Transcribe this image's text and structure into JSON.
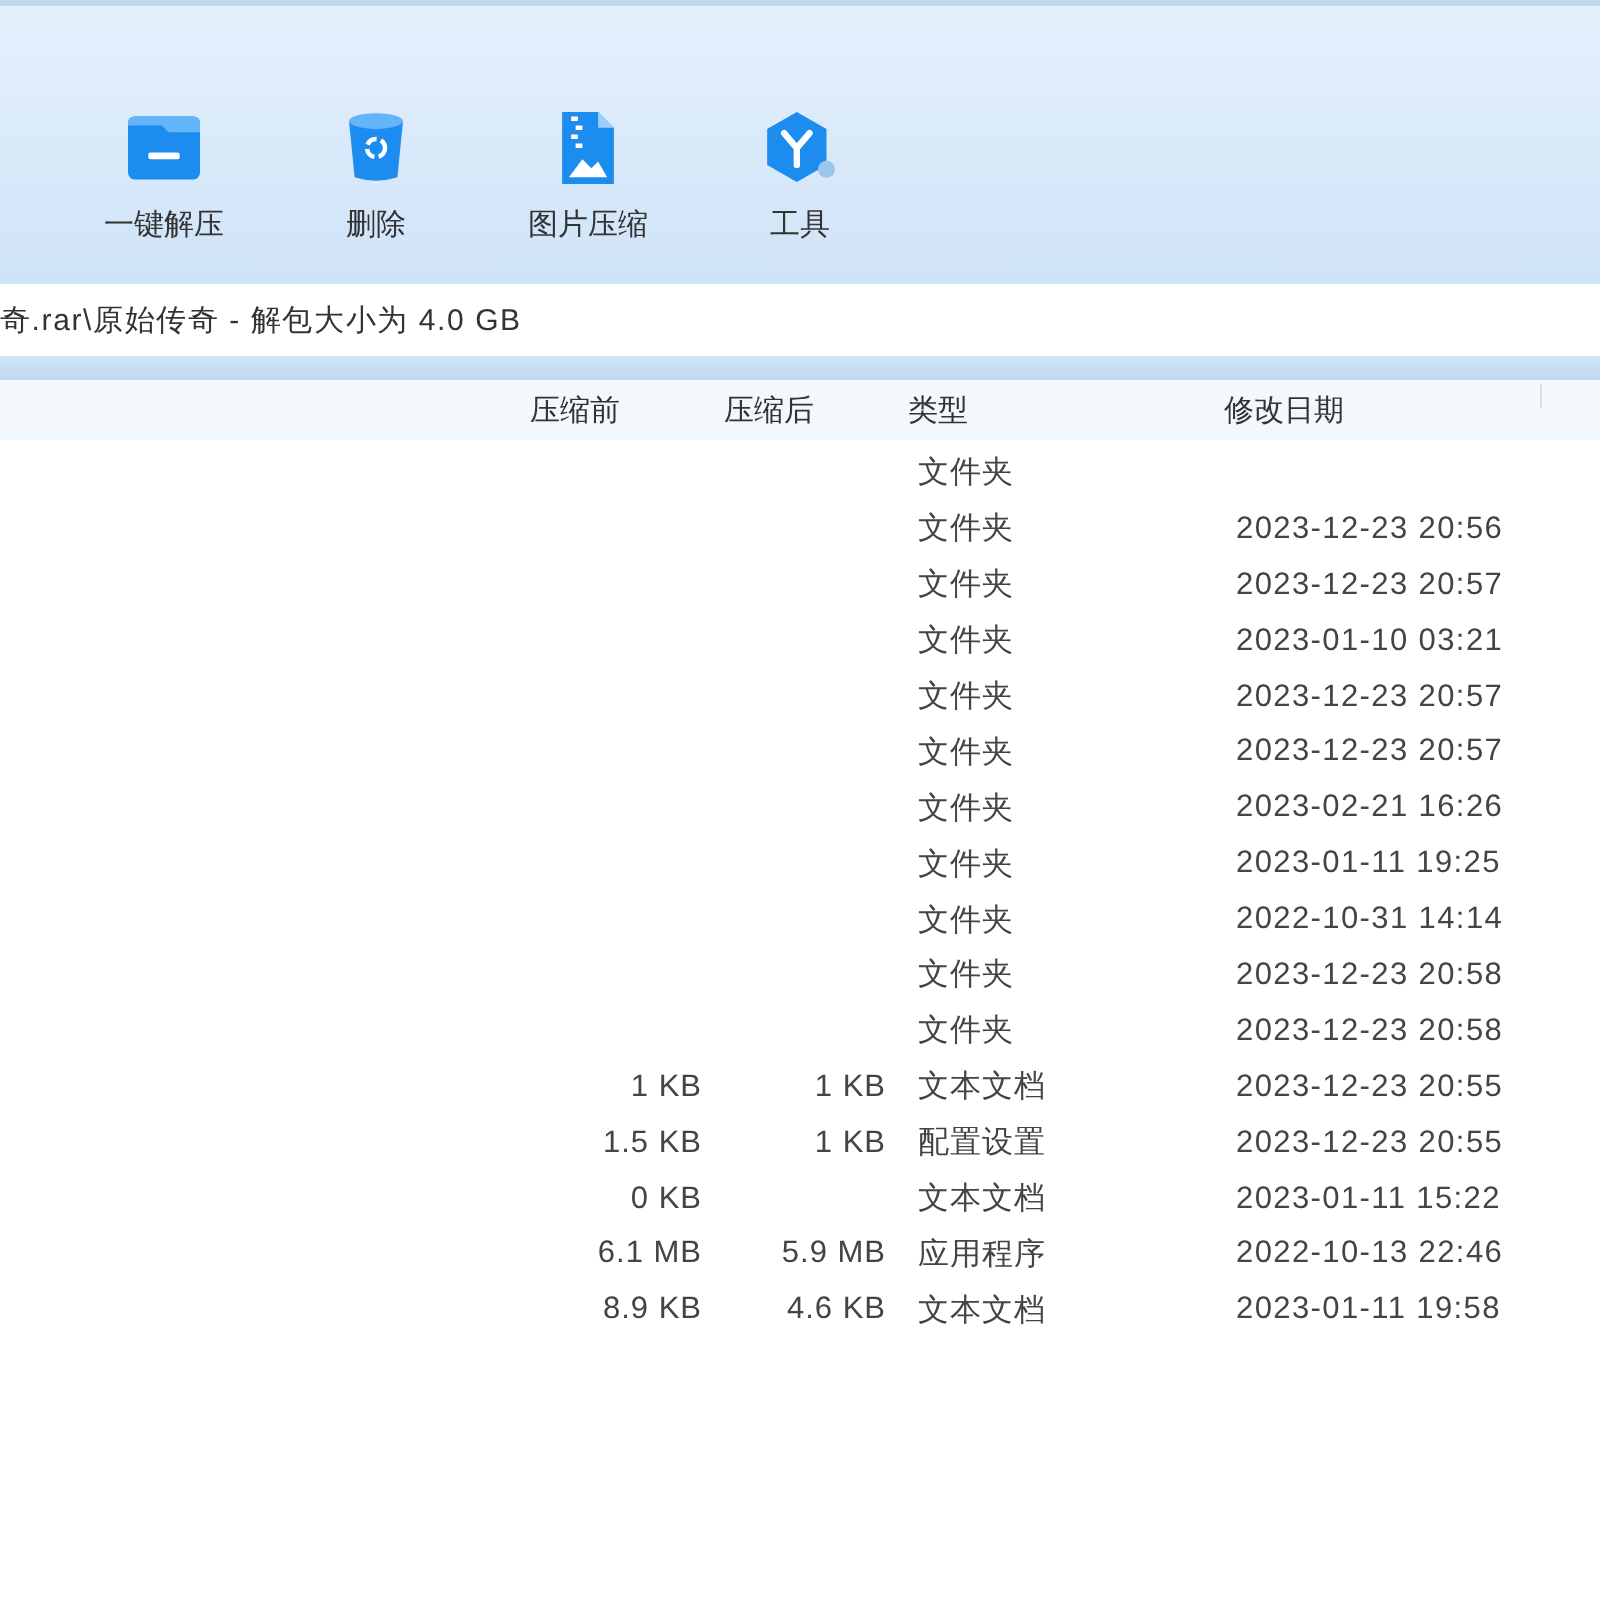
{
  "toolbar": {
    "buttons": [
      {
        "label": "一键解压",
        "kind": "extract"
      },
      {
        "label": "删除",
        "kind": "delete"
      },
      {
        "label": "图片压缩",
        "kind": "image"
      },
      {
        "label": "工具",
        "kind": "tools"
      }
    ]
  },
  "path_bar": {
    "text": "奇.rar\\原始传奇 - 解包大小为 4.0 GB"
  },
  "table": {
    "columns": [
      "压缩前",
      "压缩后",
      "类型",
      "修改日期"
    ],
    "rows": [
      {
        "type": "文件夹"
      },
      {
        "type": "文件夹",
        "modified": "2023-12-23 20:56"
      },
      {
        "type": "文件夹",
        "modified": "2023-12-23 20:57"
      },
      {
        "type": "文件夹",
        "modified": "2023-01-10 03:21"
      },
      {
        "type": "文件夹",
        "modified": "2023-12-23 20:57"
      },
      {
        "type": "文件夹",
        "modified": "2023-12-23 20:57"
      },
      {
        "type": "文件夹",
        "modified": "2023-02-21 16:26"
      },
      {
        "type": "文件夹",
        "modified": "2023-01-11 19:25"
      },
      {
        "type": "文件夹",
        "modified": "2022-10-31 14:14"
      },
      {
        "type": "文件夹",
        "modified": "2023-12-23 20:58"
      },
      {
        "type": "文件夹",
        "modified": "2023-12-23 20:58"
      },
      {
        "size_before": "1 KB",
        "size_after": "1 KB",
        "type": "文本文档",
        "modified": "2023-12-23 20:55"
      },
      {
        "size_before": "1.5 KB",
        "size_after": "1 KB",
        "type": "配置设置",
        "modified": "2023-12-23 20:55"
      },
      {
        "size_before": "0 KB",
        "type": "文本文档",
        "modified": "2023-01-11 15:22"
      },
      {
        "size_before": "6.1 MB",
        "size_after": "5.9 MB",
        "type": "应用程序",
        "modified": "2022-10-13 22:46"
      },
      {
        "size_before": "8.9 KB",
        "size_after": "4.6 KB",
        "type": "文本文档",
        "modified": "2023-01-11 19:58"
      }
    ]
  }
}
